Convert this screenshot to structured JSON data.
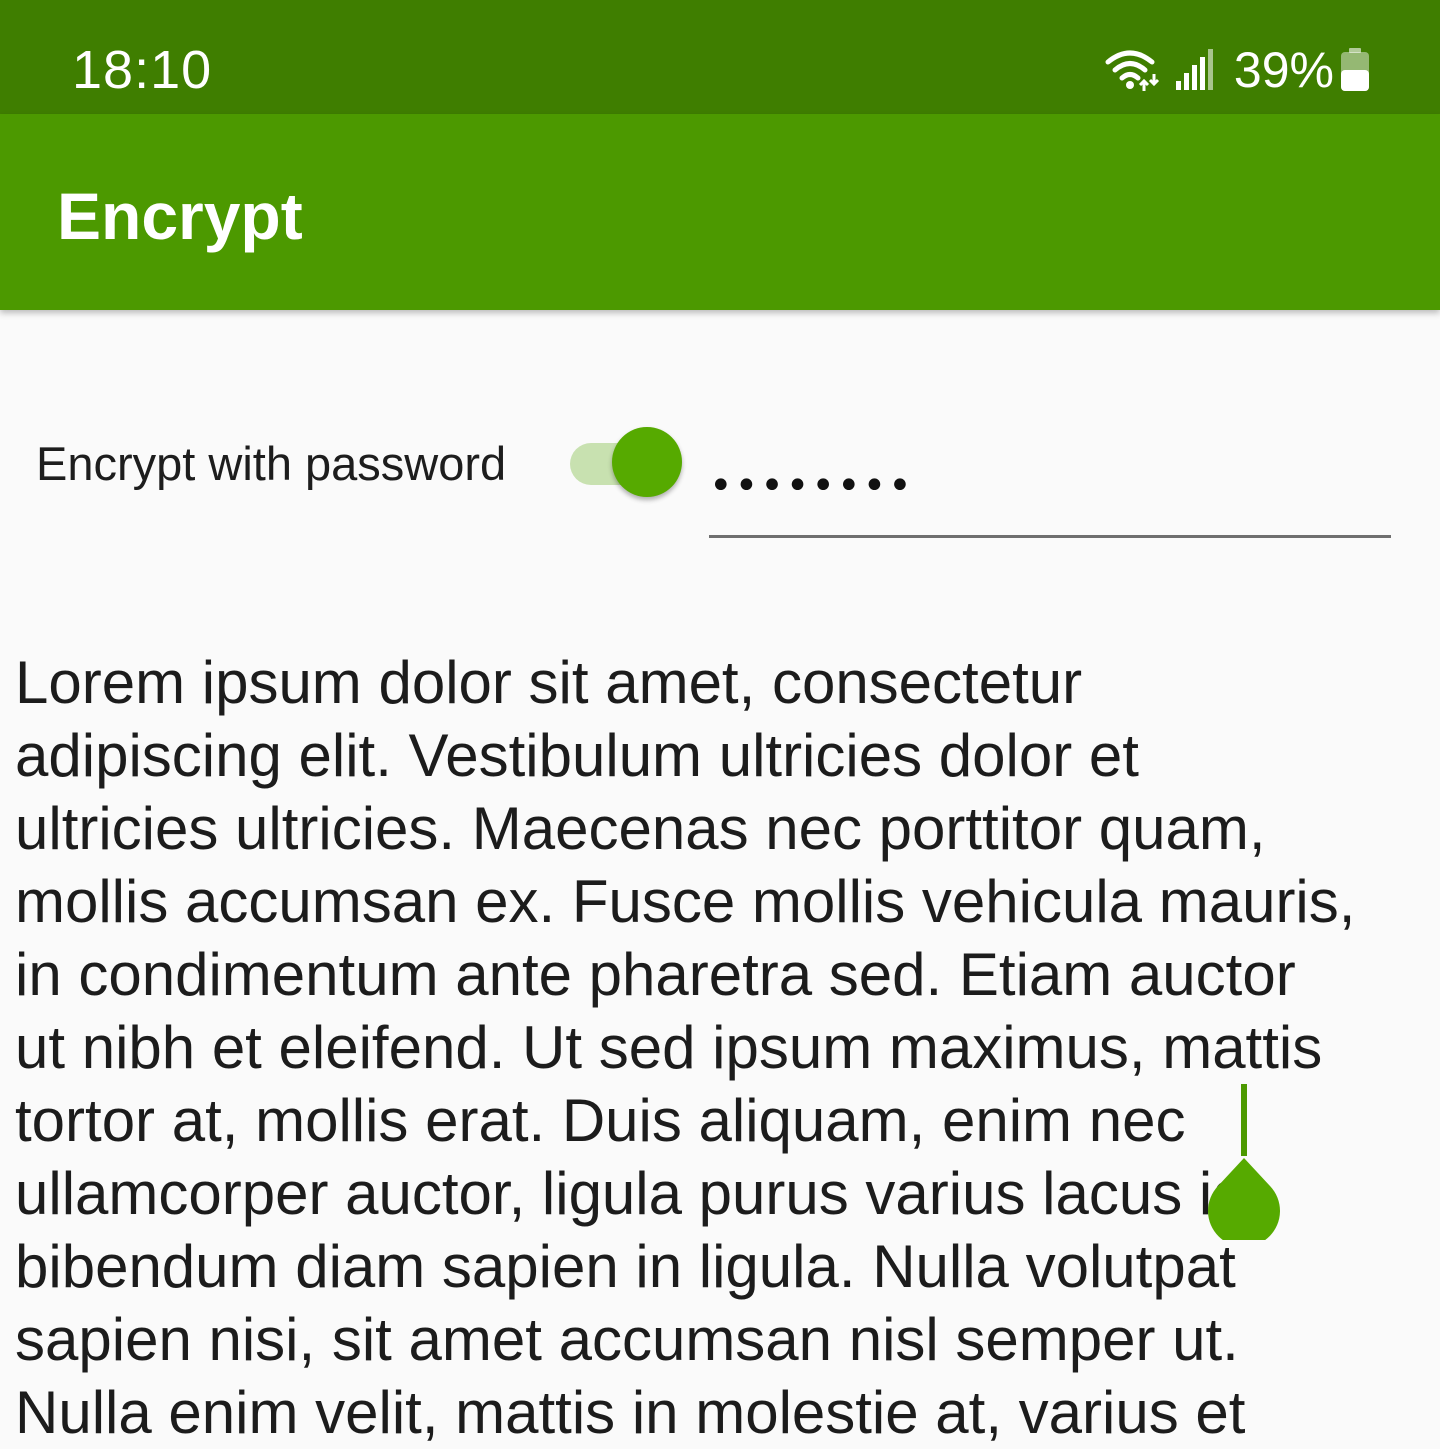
{
  "status_bar": {
    "time": "18:10",
    "battery": "39%",
    "icons": [
      "wifi-icon",
      "signal-icon",
      "battery-icon"
    ]
  },
  "app_bar": {
    "title": "Encrypt"
  },
  "options": {
    "encrypt_label": "Encrypt with password",
    "toggle_on": true,
    "password_value": "••••••••"
  },
  "editor": {
    "lines": [
      "Lorem ipsum dolor sit amet, consectetur",
      "adipiscing elit. Vestibulum ultricies dolor et",
      "ultricies ultricies. Maecenas nec porttitor quam,",
      "mollis accumsan ex. Fusce mollis vehicula mauris,",
      "in condimentum ante pharetra sed. Etiam auctor",
      "ut nibh et eleifend. Ut sed ipsum maximus, mattis",
      "tortor at, mollis erat. Duis aliquam, enim nec",
      "ullamcorper auctor, ligula purus varius lacus id",
      "bibendum diam sapien in ligula. Nulla volutpat",
      "sapien nisi, sit amet accumsan nisl semper ut.",
      "Nulla enim velit, mattis in molestie at, varius et"
    ]
  },
  "colors": {
    "status_bar": "#3f7e00",
    "app_bar": "#4c9900",
    "accent": "#56aa00",
    "toggle_track": "#c8e1b0"
  }
}
